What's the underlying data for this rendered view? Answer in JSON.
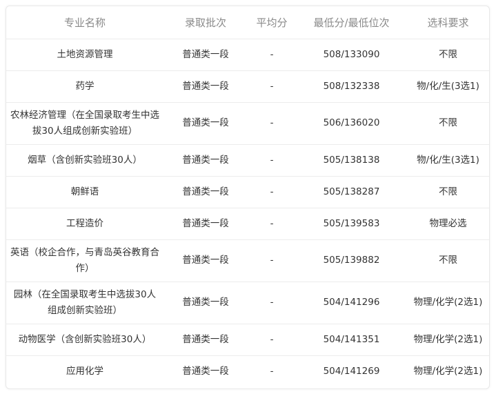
{
  "table": {
    "headers": [
      "专业名称",
      "录取批次",
      "平均分",
      "最低分/最低位次",
      "选科要求"
    ],
    "rows": [
      {
        "major": "土地资源管理",
        "batch": "普通类一段",
        "avg": "-",
        "min": "508/133090",
        "req": "不限"
      },
      {
        "major": "药学",
        "batch": "普通类一段",
        "avg": "-",
        "min": "508/132338",
        "req": "物/化/生(3选1)"
      },
      {
        "major": "农林经济管理（在全国录取考生中选拔30人组成创新实验班）",
        "batch": "普通类一段",
        "avg": "-",
        "min": "506/136020",
        "req": "不限"
      },
      {
        "major": "烟草（含创新实验班30人）",
        "batch": "普通类一段",
        "avg": "-",
        "min": "505/138138",
        "req": "物/化/生(3选1)"
      },
      {
        "major": "朝鲜语",
        "batch": "普通类一段",
        "avg": "-",
        "min": "505/138287",
        "req": "不限"
      },
      {
        "major": "工程造价",
        "batch": "普通类一段",
        "avg": "-",
        "min": "505/139583",
        "req": "物理必选"
      },
      {
        "major": "英语（校企合作，与青岛英谷教育合作）",
        "batch": "普通类一段",
        "avg": "-",
        "min": "505/139882",
        "req": "不限"
      },
      {
        "major": "园林（在全国录取考生中选拔30人组成创新实验班）",
        "batch": "普通类一段",
        "avg": "-",
        "min": "504/141296",
        "req": "物理/化学(2选1)"
      },
      {
        "major": "动物医学（含创新实验班30人）",
        "batch": "普通类一段",
        "avg": "-",
        "min": "504/141351",
        "req": "物理/化学(2选1)"
      },
      {
        "major": "应用化学",
        "batch": "普通类一段",
        "avg": "-",
        "min": "504/141269",
        "req": "物理/化学(2选1)"
      }
    ]
  }
}
